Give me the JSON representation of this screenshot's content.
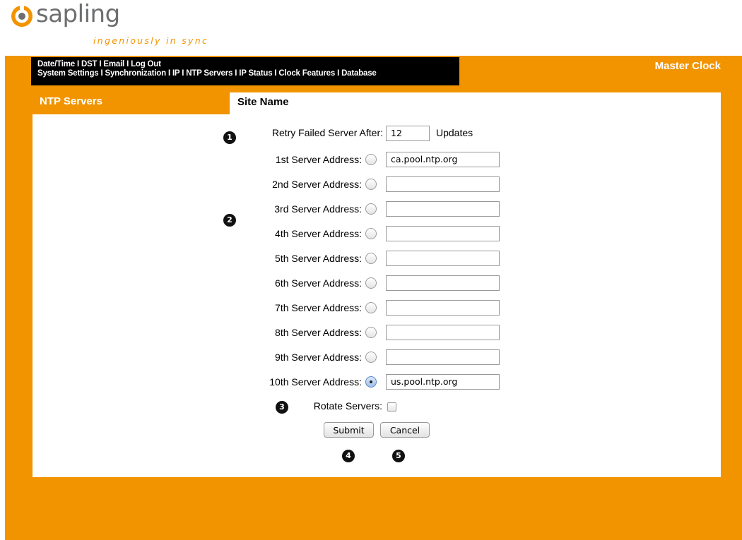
{
  "brand": {
    "name": "sapling",
    "tagline": "ingeniously in sync",
    "accent": "#f29400",
    "logo_color": "#6d6e70"
  },
  "nav": {
    "row1": [
      "Date/Time",
      "DST",
      "Email",
      "Log Out"
    ],
    "row2": [
      "System Settings",
      "Synchronization",
      "IP",
      "NTP Servers",
      "IP Status",
      "Clock Features",
      "Database"
    ],
    "separator": "I"
  },
  "header": {
    "device": "Master Clock"
  },
  "sidebar": {
    "title": "NTP Servers"
  },
  "main": {
    "site_name": "Site Name",
    "retry": {
      "label": "Retry Failed Server After:",
      "value": "12",
      "unit": "Updates"
    },
    "servers": [
      {
        "label": "1st Server Address:",
        "value": "ca.pool.ntp.org",
        "selected": false
      },
      {
        "label": "2nd Server Address:",
        "value": "",
        "selected": false
      },
      {
        "label": "3rd Server Address:",
        "value": "",
        "selected": false
      },
      {
        "label": "4th Server Address:",
        "value": "",
        "selected": false
      },
      {
        "label": "5th Server Address:",
        "value": "",
        "selected": false
      },
      {
        "label": "6th Server Address:",
        "value": "",
        "selected": false
      },
      {
        "label": "7th Server Address:",
        "value": "",
        "selected": false
      },
      {
        "label": "8th Server Address:",
        "value": "",
        "selected": false
      },
      {
        "label": "9th Server Address:",
        "value": "",
        "selected": false
      },
      {
        "label": "10th Server Address:",
        "value": "us.pool.ntp.org",
        "selected": true
      }
    ],
    "rotate": {
      "label": "Rotate Servers:",
      "checked": false
    },
    "submit_label": "Submit",
    "cancel_label": "Cancel"
  },
  "callouts": [
    "1",
    "2",
    "3",
    "4",
    "5"
  ]
}
